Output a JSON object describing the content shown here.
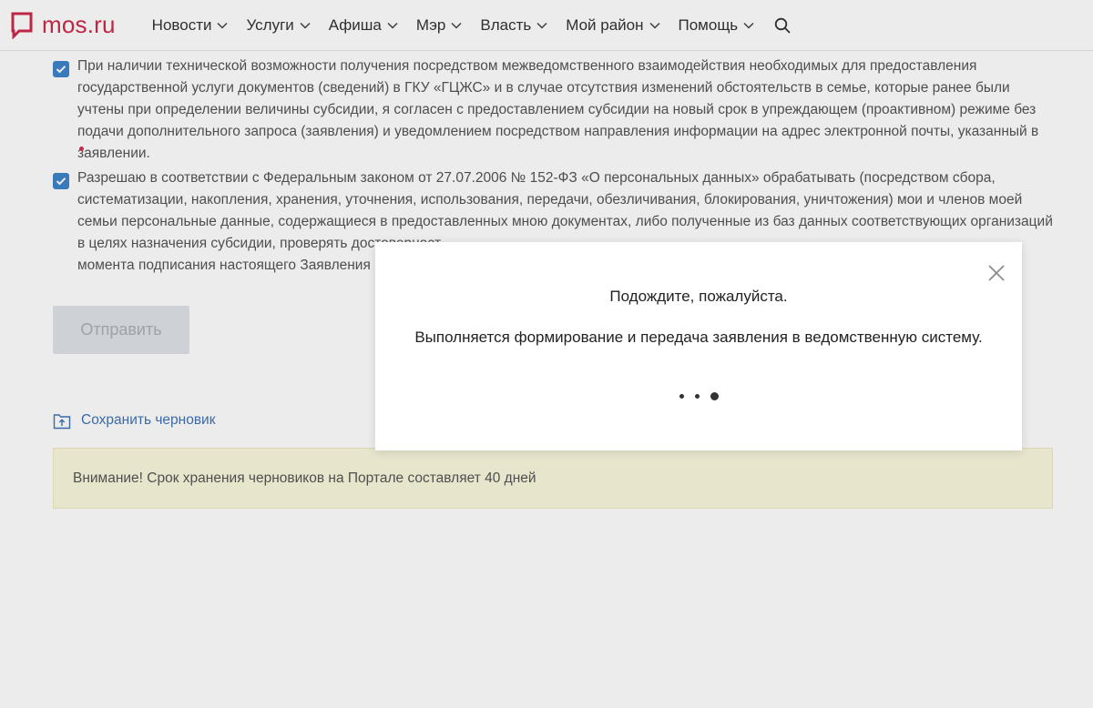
{
  "header": {
    "logo_text": "mos.ru",
    "brand_color": "#cc2b4b",
    "nav": [
      {
        "label": "Новости"
      },
      {
        "label": "Услуги"
      },
      {
        "label": "Афиша"
      },
      {
        "label": "Мэр"
      },
      {
        "label": "Власть"
      },
      {
        "label": "Мой район"
      },
      {
        "label": "Помощь"
      }
    ],
    "search_icon": "search-icon"
  },
  "form": {
    "consent1": {
      "checked": true,
      "text": "При наличии технической возможности получения посредством межведомственного взаимодействия необходимых для предоставления государственной услуги документов (сведений) в ГКУ «ГЦЖС» и в случае отсутствия изменений обстоятельств в семье, которые ранее были учтены при определении величины субсидии, я согласен с предоставлением субсидии на новый срок в упреждающем (проактивном) режиме без подачи дополнительного запроса (заявления) и уведомлением посредством направления информации на адрес электронной почты, указанный в заявлении."
    },
    "consent2": {
      "checked": true,
      "text": "Разрешаю в соответствии с Федеральным законом от 27.07.2006 № 152-ФЗ «О персональных данных» обрабатывать (посредством сбора, систематизации, накопления, хранения, уточнения, использования, передачи, обезличивания, блокирования, уничтожения) мои и членов моей семьи персональные данные, содержащиеся в предоставленных мною документах, либо полученные из баз данных соответствующих организаций в целях назначения субсидии, проверять достоверност",
      "text_tail": "момента подписания настоящего Заявления и"
    },
    "submit_label": "Отправить",
    "save_draft_label": "Сохранить черновик",
    "warning_text": "Внимание! Срок хранения черновиков на Портале составляет 40 дней"
  },
  "modal": {
    "title": "Подождите, пожалуйста.",
    "message": "Выполняется формирование и передача заявления в ведомственную систему.",
    "close_icon": "close-icon"
  },
  "colors": {
    "checkbox": "#3e84c9",
    "link": "#3f73b5",
    "warning_bg": "#fbf8de"
  }
}
